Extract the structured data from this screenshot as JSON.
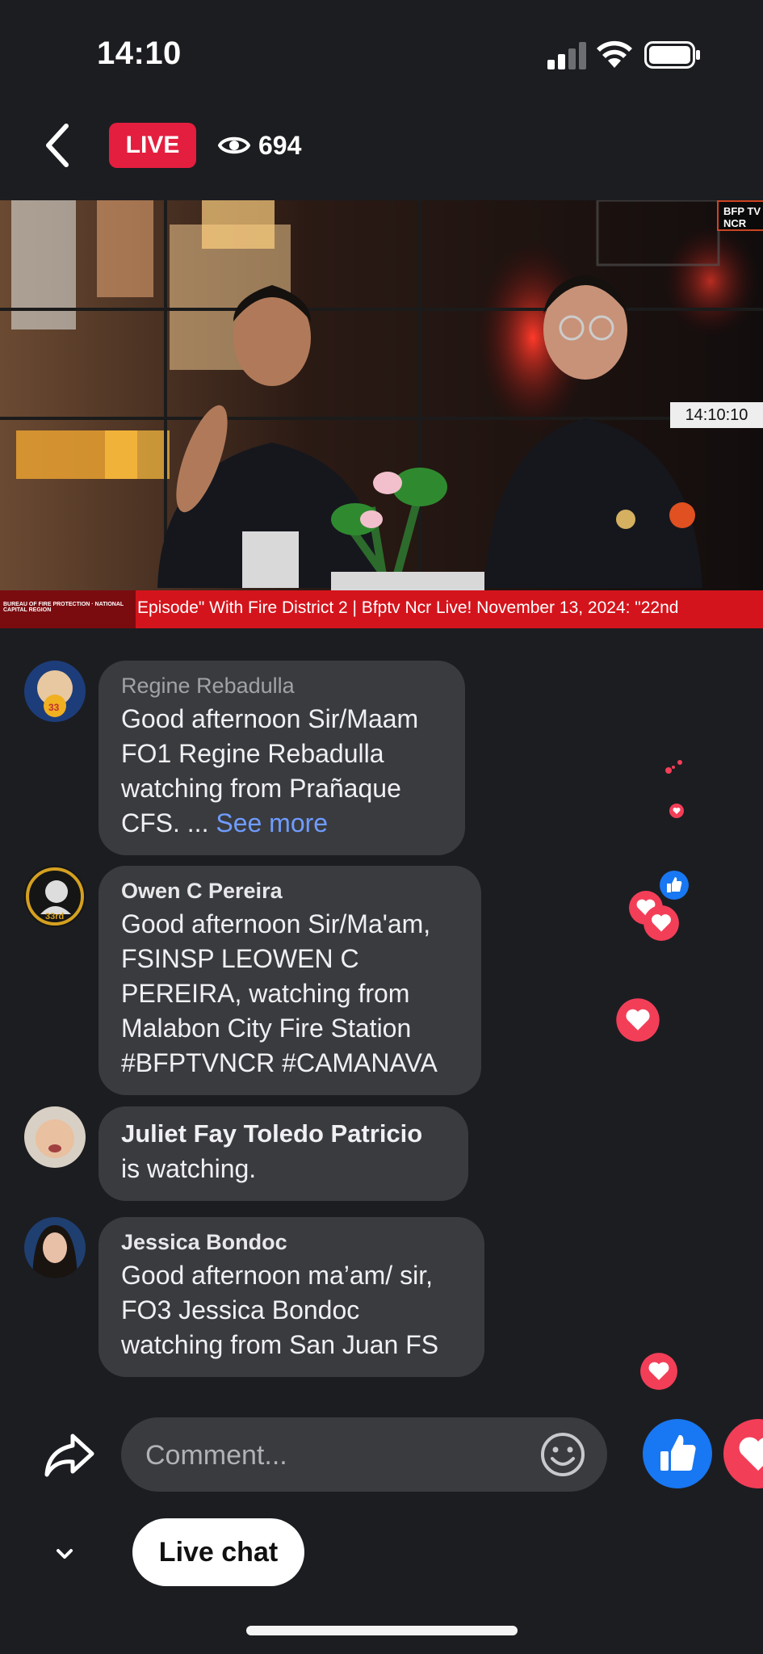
{
  "status_bar": {
    "time": "14:10"
  },
  "header": {
    "live_label": "LIVE",
    "viewer_count": "694"
  },
  "video": {
    "ticker_text": "Episode\" With Fire District 2  |  Bfptv Ncr Live! November 13, 2024:   \"22nd",
    "ticker_logo_text": "BUREAU OF FIRE PROTECTION · NATIONAL CAPITAL REGION",
    "clock": "14:10:10",
    "channel_logo": "BFP TV NCR"
  },
  "comments": [
    {
      "author": "Regine Rebadulla",
      "lines": [
        "Good afternoon Sir/Maam",
        "FO1 Regine Rebadulla",
        "watching from Prañaque",
        "CFS. ..."
      ],
      "see_more": "See more"
    },
    {
      "author": "Owen C Pereira",
      "lines": [
        "Good afternoon Sir/Ma'am,",
        "FSINSP LEOWEN C",
        "PEREIRA, watching from",
        "Malabon City Fire Station",
        "#BFPTVNCR #CAMANAVA"
      ]
    },
    {
      "author": "Juliet Fay Toledo Patricio",
      "lines": [
        "is watching."
      ]
    },
    {
      "author": "Jessica Bondoc",
      "lines": [
        "Good afternoon ma’am/ sir,",
        "FO3 Jessica Bondoc",
        "watching from San Juan FS"
      ]
    }
  ],
  "composer": {
    "placeholder": "Comment..."
  },
  "footer": {
    "live_chat_label": "Live chat"
  },
  "colors": {
    "live_red": "#e41e3f",
    "like_blue": "#1877f2",
    "love_red": "#f33e58",
    "link_blue": "#6f9cff"
  }
}
